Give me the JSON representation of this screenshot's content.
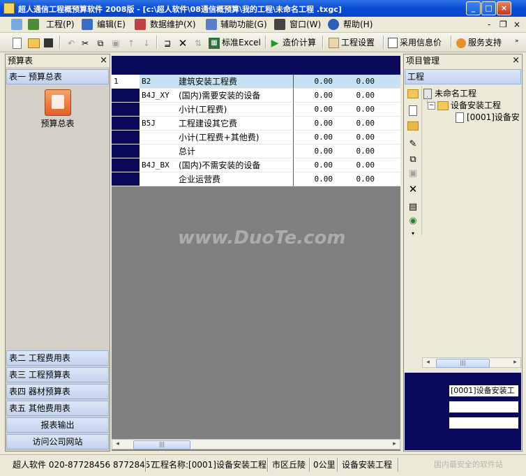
{
  "window": {
    "title": "超人通信工程概预算软件 2008版 - [c:\\超人软件\\08通信概预算\\我的工程\\未命名工程 .txgc]",
    "controls": [
      "_",
      "□",
      "×"
    ]
  },
  "menu": {
    "items": [
      {
        "label": "工程(P)",
        "icon": "project-icon"
      },
      {
        "label": "编辑(E)",
        "icon": "edit-icon"
      },
      {
        "label": "数据维护(X)",
        "icon": "data-maintenance-icon"
      },
      {
        "label": "辅助功能(G)",
        "icon": "assist-icon"
      },
      {
        "label": "窗口(W)",
        "icon": "window-icon"
      },
      {
        "label": "帮助(H)",
        "icon": "help-icon"
      }
    ],
    "right_controls": [
      "-",
      "❐",
      "×"
    ]
  },
  "toolbar": {
    "standard_excel": "标准Excel",
    "cost_calc": "造价计算",
    "project_settings": "工程设置",
    "use_info_price": "采用信息价",
    "service_support": "服务支持"
  },
  "left_panel": {
    "header": "预算表",
    "top_item": "表一 预算总表",
    "icon_caption": "预算总表",
    "nav_items": [
      "表二 工程费用表",
      "表三 工程预算表",
      "表四 器材预算表",
      "表五 其他费用表",
      "报表输出",
      "访问公司网站"
    ]
  },
  "grid": {
    "rows": [
      {
        "no": "1",
        "code": "B2",
        "name": "建筑安装工程费",
        "v1": "0.00",
        "v2": "0.00"
      },
      {
        "no": "",
        "code": "B4J_XY",
        "name": "(国内)需要安装的设备",
        "v1": "0.00",
        "v2": "0.00"
      },
      {
        "no": "",
        "code": "",
        "name": "小计(工程费)",
        "v1": "0.00",
        "v2": "0.00"
      },
      {
        "no": "",
        "code": "B5J",
        "name": "工程建设其它费",
        "v1": "0.00",
        "v2": "0.00"
      },
      {
        "no": "",
        "code": "",
        "name": "小计(工程费+其他费)",
        "v1": "0.00",
        "v2": "0.00"
      },
      {
        "no": "",
        "code": "",
        "name": "总计",
        "v1": "0.00",
        "v2": "0.00"
      },
      {
        "no": "",
        "code": "B4J_BX",
        "name": "(国内)不需安装的设备",
        "v1": "0.00",
        "v2": "0.00"
      },
      {
        "no": "",
        "code": "",
        "name": "企业运营费",
        "v1": "0.00",
        "v2": "0.00"
      }
    ],
    "watermark": "www.DuoTe.com"
  },
  "right_panel": {
    "header": "项目管理",
    "tab": "工程",
    "tree": {
      "root": "未命名工程",
      "child": "设备安装工程",
      "leaf": "[0001]设备安"
    },
    "property_value": "[0001]设备安装工"
  },
  "status": {
    "company": "超人软件 020-87728456 87728457",
    "project_name": "工程名称:[0001]设备安装工程",
    "region": "市区丘陵",
    "distance": "0公里",
    "project_type": "设备安装工程",
    "watermark": "国内最安全的软件站"
  }
}
